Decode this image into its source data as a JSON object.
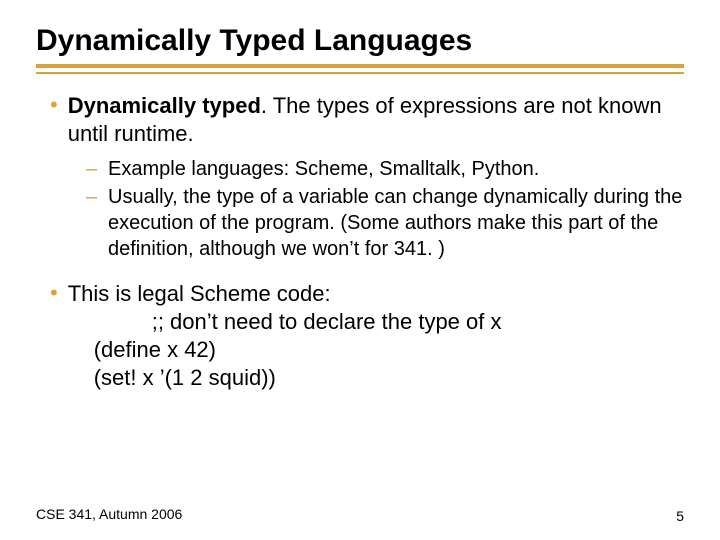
{
  "title": "Dynamically Typed Languages",
  "bullet1": {
    "bold": "Dynamically typed",
    "rest": ". The types of expressions are not known until runtime."
  },
  "sub1": "Example languages: Scheme, Smalltalk, Python.",
  "sub2": "Usually, the type of a variable can change dynamically during the execution of the program. (Some authors make this part of the definition, although we won’t for 341. )",
  "bullet2": "This is legal Scheme code:",
  "code": {
    "l1": ";; don’t need to declare the type of x",
    "l2": "(define x 42)",
    "l3": "(set! x ’(1 2 squid))"
  },
  "footer_left": "CSE 341, Autumn 2006",
  "footer_right": "5"
}
